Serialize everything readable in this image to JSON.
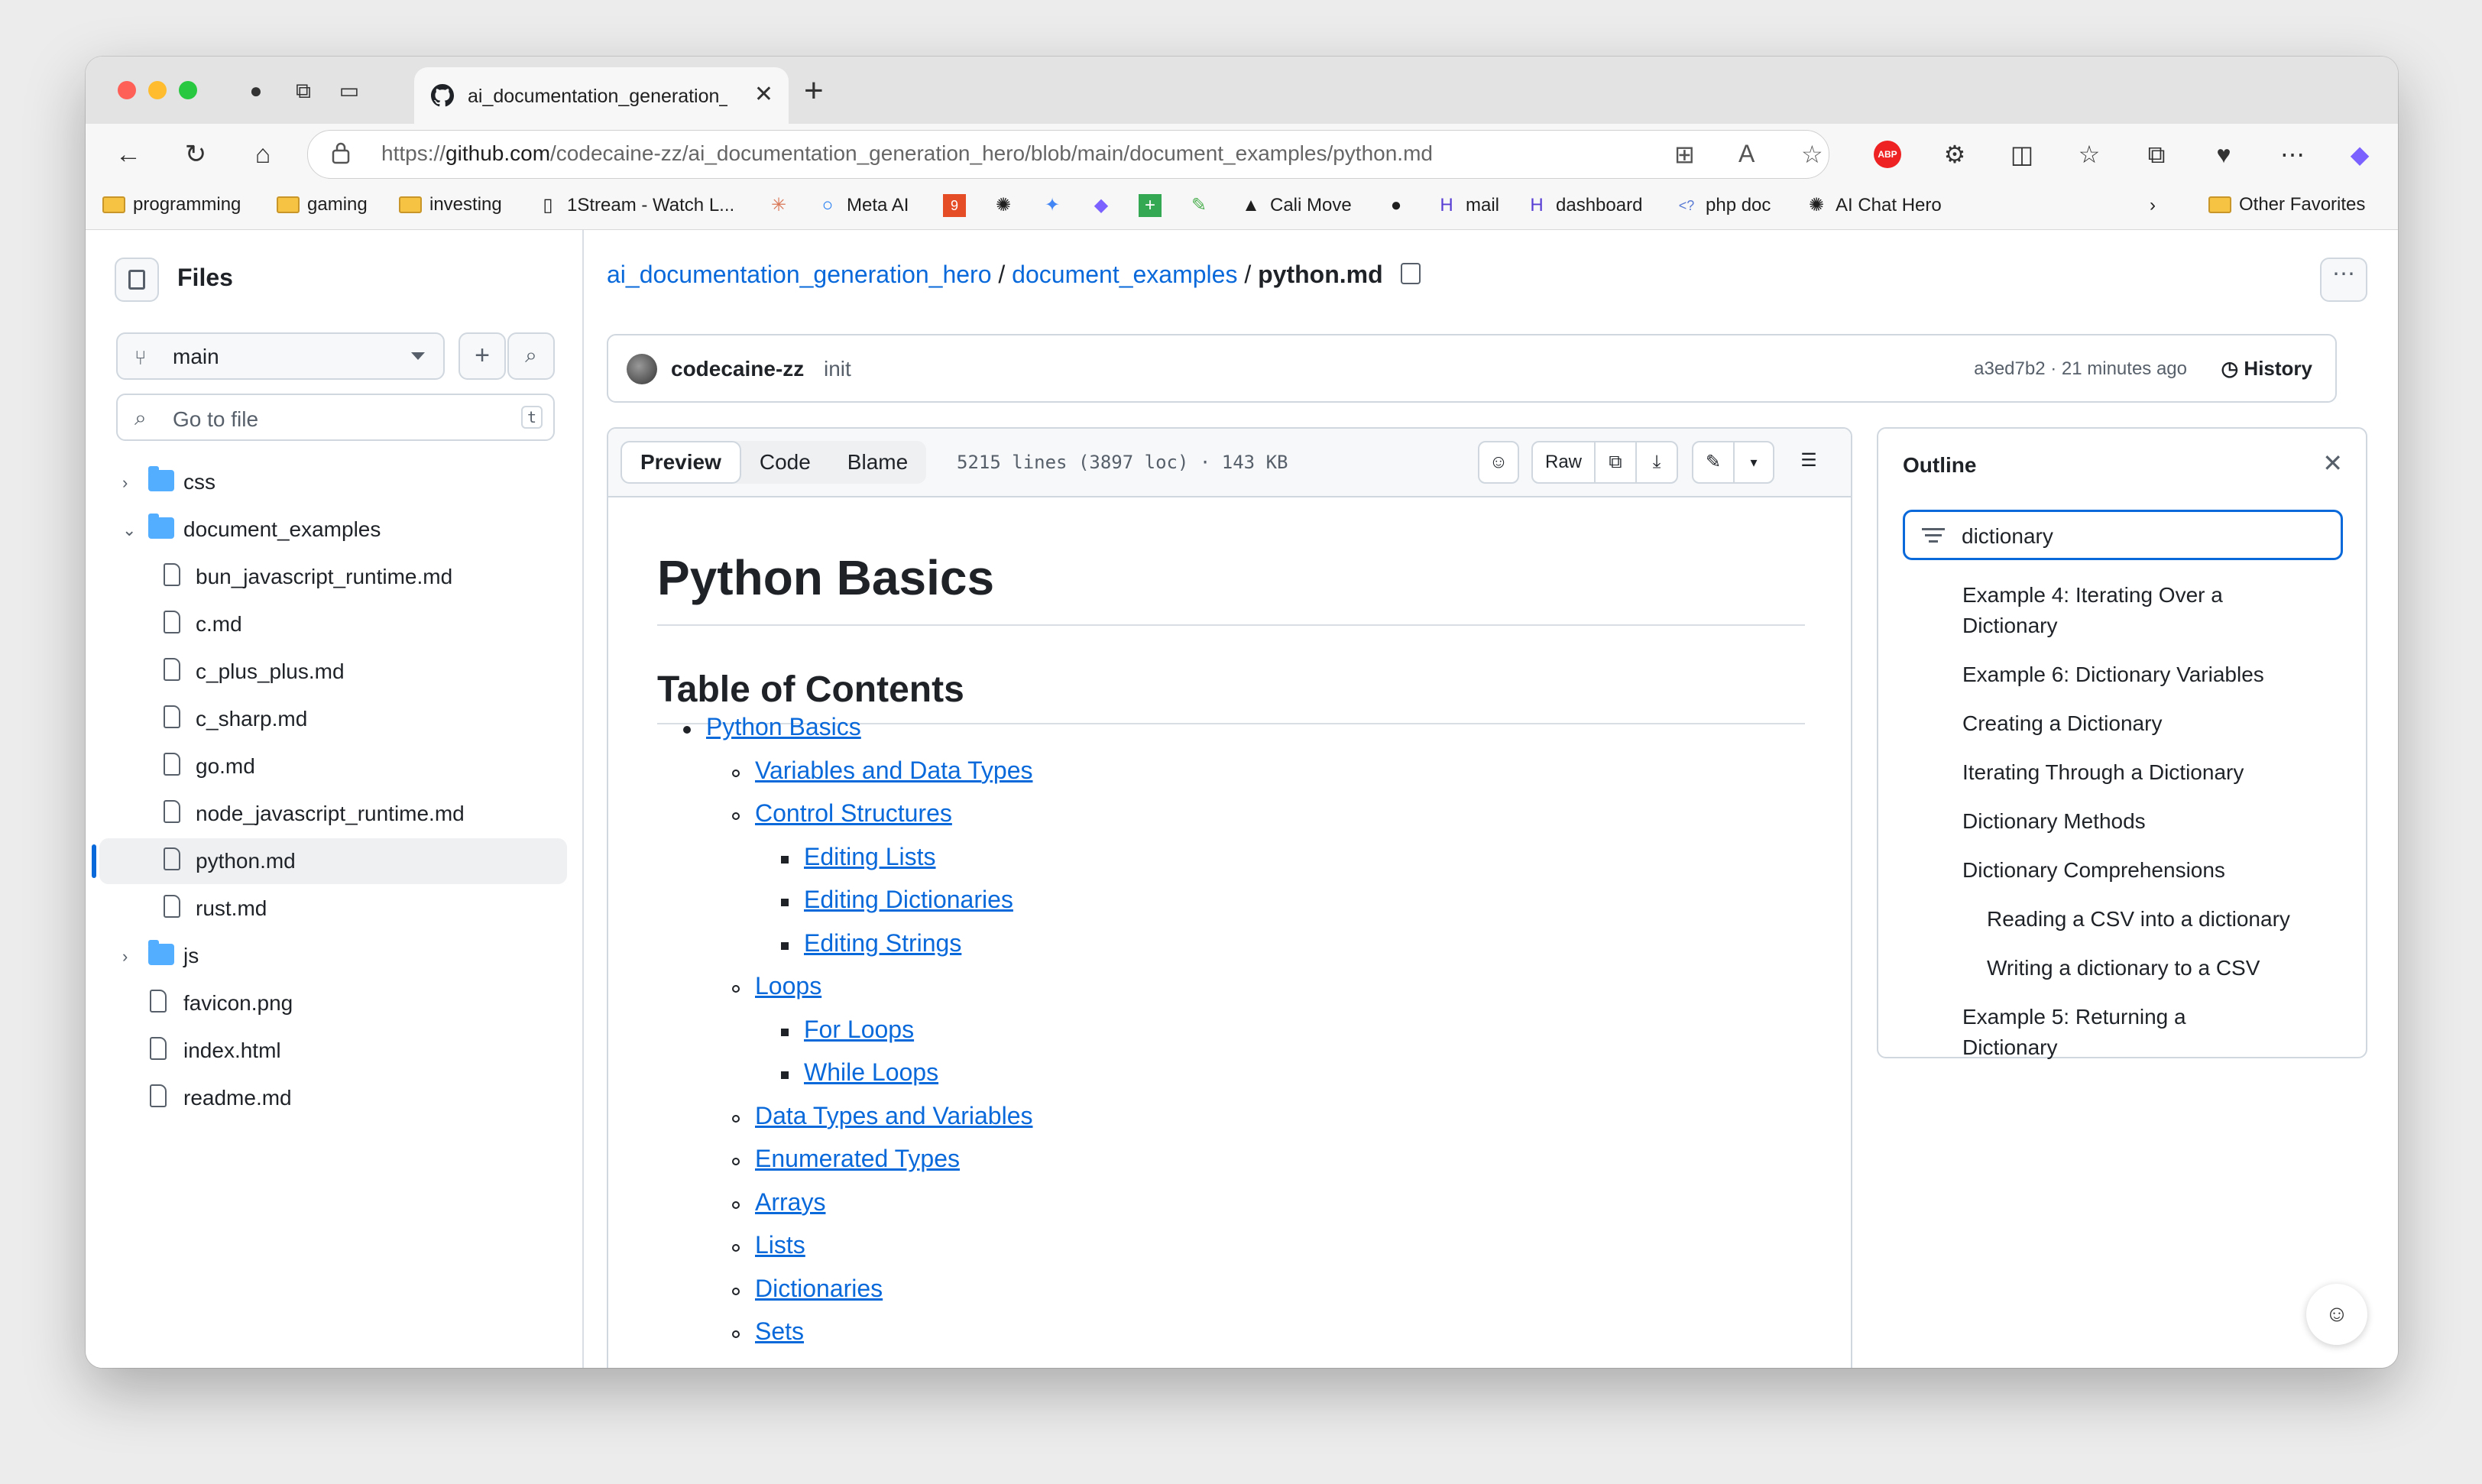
{
  "browser": {
    "tab_title": "ai_documentation_generation_hero",
    "url_prefix": "https://",
    "url_host": "github.com",
    "url_path": "/codecaine-zz/ai_documentation_generation_hero/blob/main/document_examples/python.md",
    "bookmarks": [
      "programming",
      "gaming",
      "investing",
      "1Stream - Watch L...",
      "Meta AI",
      "Cali Move",
      "mail",
      "dashboard",
      "php doc",
      "AI Chat Hero"
    ],
    "other_favorites": "Other Favorites"
  },
  "sidebar": {
    "title": "Files",
    "branch": "main",
    "goto_placeholder": "Go to file",
    "goto_shortcut": "t",
    "tree": [
      {
        "label": "css",
        "type": "dir",
        "depth": 0,
        "expanded": false
      },
      {
        "label": "document_examples",
        "type": "dir",
        "depth": 0,
        "expanded": true
      },
      {
        "label": "bun_javascript_runtime.md",
        "type": "file",
        "depth": 1
      },
      {
        "label": "c.md",
        "type": "file",
        "depth": 1
      },
      {
        "label": "c_plus_plus.md",
        "type": "file",
        "depth": 1
      },
      {
        "label": "c_sharp.md",
        "type": "file",
        "depth": 1
      },
      {
        "label": "go.md",
        "type": "file",
        "depth": 1
      },
      {
        "label": "node_javascript_runtime.md",
        "type": "file",
        "depth": 1
      },
      {
        "label": "python.md",
        "type": "file",
        "depth": 1,
        "selected": true
      },
      {
        "label": "rust.md",
        "type": "file",
        "depth": 1
      },
      {
        "label": "js",
        "type": "dir",
        "depth": 0,
        "expanded": false
      },
      {
        "label": "favicon.png",
        "type": "file",
        "depth": 0
      },
      {
        "label": "index.html",
        "type": "file",
        "depth": 0
      },
      {
        "label": "readme.md",
        "type": "file",
        "depth": 0
      }
    ]
  },
  "breadcrumb": {
    "repo": "ai_documentation_generation_hero",
    "sep": "/",
    "folder": "document_examples",
    "file": "python.md"
  },
  "commit": {
    "author": "codecaine-zz",
    "message": "init",
    "meta": "a3ed7b2 · 21 minutes ago",
    "history": "History"
  },
  "viewer": {
    "tabs": [
      "Preview",
      "Code",
      "Blame"
    ],
    "file_meta": "5215 lines (3897 loc) · 143 KB",
    "raw": "Raw"
  },
  "doc": {
    "h1": "Python Basics",
    "h2": "Table of Contents",
    "toc": [
      {
        "label": "Python Basics",
        "level": 0
      },
      {
        "label": "Variables and Data Types",
        "level": 1
      },
      {
        "label": "Control Structures",
        "level": 1
      },
      {
        "label": "Editing Lists",
        "level": 2
      },
      {
        "label": "Editing Dictionaries",
        "level": 2
      },
      {
        "label": "Editing Strings",
        "level": 2
      },
      {
        "label": "Loops",
        "level": 1
      },
      {
        "label": "For Loops",
        "level": 2
      },
      {
        "label": "While Loops",
        "level": 2
      },
      {
        "label": "Data Types and Variables",
        "level": 1
      },
      {
        "label": "Enumerated Types",
        "level": 1
      },
      {
        "label": "Arrays",
        "level": 1
      },
      {
        "label": "Lists",
        "level": 1
      },
      {
        "label": "Dictionaries",
        "level": 1
      },
      {
        "label": "Sets",
        "level": 1
      }
    ]
  },
  "outline": {
    "title": "Outline",
    "filter_value": "dictionary",
    "items": [
      {
        "label": "Example 4: Iterating Over a Dictionary",
        "level": 0
      },
      {
        "label": "Example 6: Dictionary Variables",
        "level": 0
      },
      {
        "label": "Creating a Dictionary",
        "level": 0
      },
      {
        "label": "Iterating Through a Dictionary",
        "level": 0
      },
      {
        "label": "Dictionary Methods",
        "level": 0
      },
      {
        "label": "Dictionary Comprehensions",
        "level": 0
      },
      {
        "label": "Reading a CSV into a dictionary",
        "level": 1
      },
      {
        "label": "Writing a dictionary to a CSV",
        "level": 1
      },
      {
        "label": "Example 5: Returning a Dictionary",
        "level": 0
      }
    ]
  },
  "colors": {
    "link": "#0969da",
    "accent": "#0969da"
  }
}
